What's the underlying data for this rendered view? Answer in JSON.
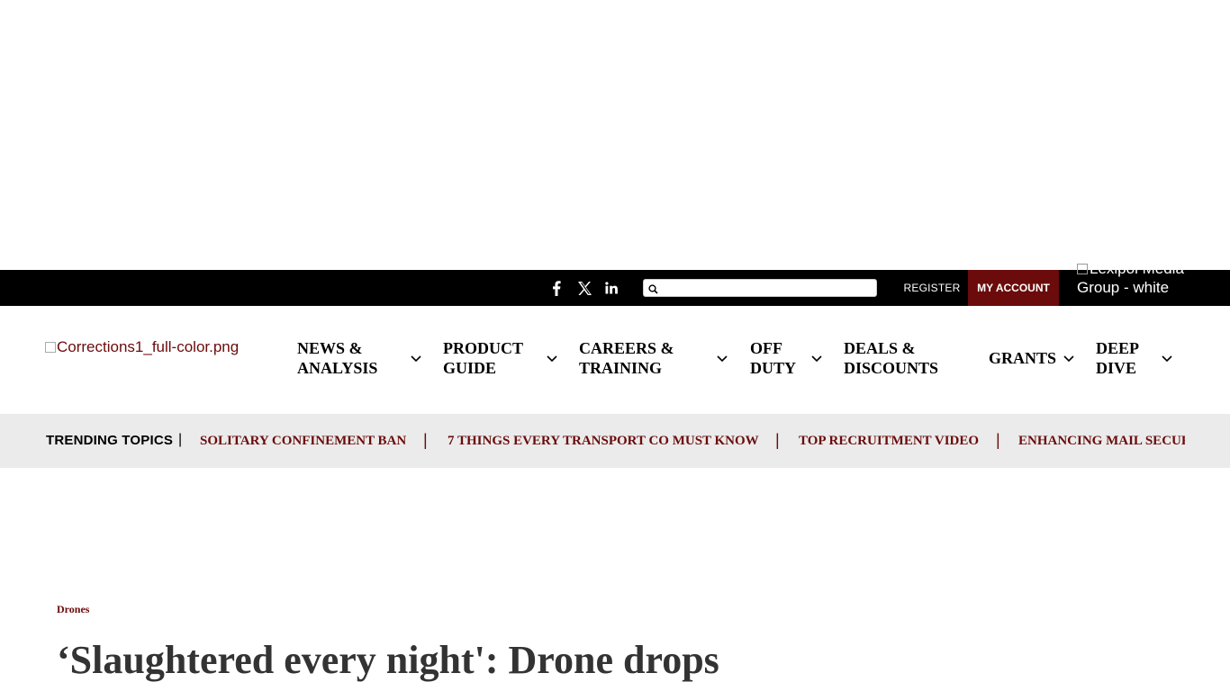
{
  "topbar": {
    "social": [
      "facebook-icon",
      "x-twitter-icon",
      "linkedin-icon"
    ],
    "search_placeholder": "",
    "register_label": "REGISTER",
    "my_account_label": "MY ACCOUNT",
    "lexipol_alt": "Lexipol Media Group - white"
  },
  "logo": {
    "alt": "Corrections1_full-color.png"
  },
  "nav": {
    "items": [
      {
        "line1": "NEWS &",
        "line2": "ANALYSIS"
      },
      {
        "line1": "PRODUCT",
        "line2": "GUIDE"
      },
      {
        "line1": "CAREERS &",
        "line2": "TRAINING"
      },
      {
        "line1": "OFF",
        "line2": "DUTY"
      },
      {
        "line1": "DEALS &",
        "line2": "DISCOUNTS"
      },
      {
        "line1": "GRANTS",
        "line2": ""
      },
      {
        "line1": "DEEP",
        "line2": "DIVE"
      }
    ]
  },
  "trending": {
    "title": "TRENDING TOPICS",
    "pipe": "|",
    "links": [
      "SOLITARY CONFINEMENT BAN",
      "7 THINGS EVERY TRANSPORT CO MUST KNOW",
      "TOP RECRUITMENT VIDEO",
      "ENHANCING MAIL SECURITY"
    ],
    "separator": "|"
  },
  "article": {
    "category": "Drones",
    "headline": "‘Slaughtered every night': Drone drops"
  },
  "colors": {
    "brand": "#6b0b0b",
    "topbar": "#000000",
    "trending_bg": "#ebebeb"
  }
}
